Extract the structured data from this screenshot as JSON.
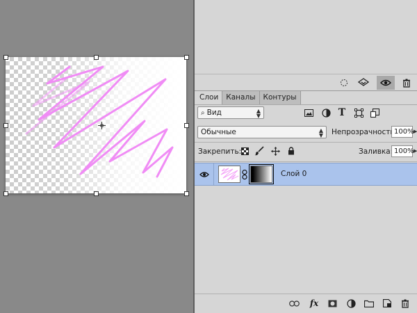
{
  "tabs": [
    {
      "label": "Слои"
    },
    {
      "label": "Каналы"
    },
    {
      "label": "Контуры"
    }
  ],
  "filter": {
    "label": "Вид"
  },
  "blend_mode": {
    "value": "Обычные"
  },
  "opacity": {
    "label": "Непрозрачность:",
    "value": "100%"
  },
  "lock": {
    "label": "Закрепить:"
  },
  "fill": {
    "label": "Заливка:",
    "value": "100%"
  },
  "layers": [
    {
      "name": "Слой 0",
      "visible": true
    }
  ],
  "colors": {
    "selection_blue": "#aac3ec",
    "stroke_pink": "#f08cf5",
    "panel_gray": "#d6d6d6"
  },
  "icons": {
    "filter_types": [
      "image-icon",
      "adjustment-icon",
      "type-icon",
      "shape-icon",
      "smart-object-icon"
    ],
    "lock_types": [
      "lock-transparent-icon",
      "lock-paint-icon",
      "lock-position-icon",
      "lock-all-icon"
    ],
    "bottom_bar": [
      "link-layers-icon",
      "fx-icon",
      "add-mask-icon",
      "adjustment-layer-icon",
      "group-icon",
      "new-layer-icon",
      "delete-icon"
    ]
  }
}
